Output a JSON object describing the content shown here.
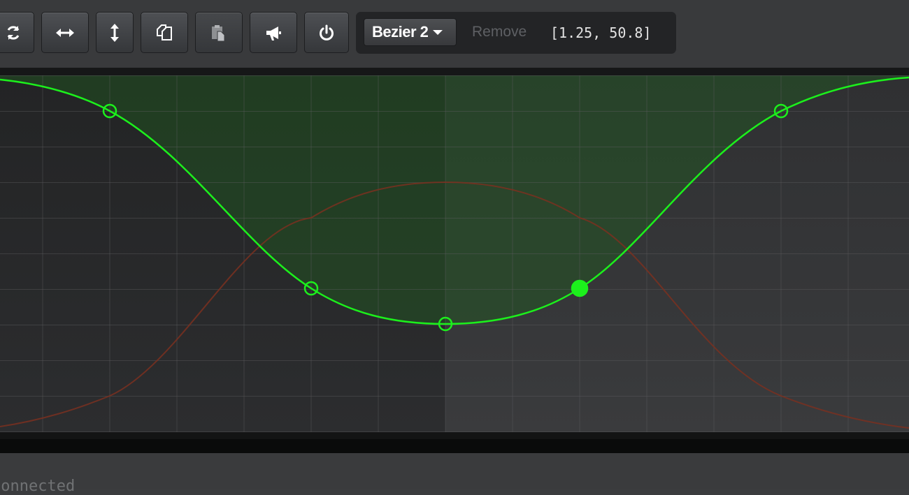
{
  "toolbar": {
    "buttons": [
      {
        "name": "refresh-button",
        "icon": "refresh-icon",
        "disabled": false
      },
      {
        "name": "flip-horizontal-button",
        "icon": "arrows-horizontal-icon",
        "disabled": false
      },
      {
        "name": "flip-vertical-button",
        "icon": "arrows-vertical-icon",
        "disabled": false
      },
      {
        "name": "copy-button",
        "icon": "copy-icon",
        "disabled": false
      },
      {
        "name": "paste-button",
        "icon": "paste-icon",
        "disabled": true
      },
      {
        "name": "announce-button",
        "icon": "megaphone-icon",
        "disabled": false
      },
      {
        "name": "power-button",
        "icon": "power-icon",
        "disabled": false
      }
    ],
    "bezier_select": {
      "value": "Bezier 2"
    },
    "remove_label": "Remove",
    "coords_readout": "[1.25, 50.8]"
  },
  "graph": {
    "colors": {
      "active_curve": "#1cf01c",
      "mirror_curve": "#7a3020",
      "fill": "#1e5a1e",
      "grid": "#5a5c5e"
    },
    "control_points": [
      {
        "name": "control-point-1",
        "selected": false
      },
      {
        "name": "control-point-2",
        "selected": false
      },
      {
        "name": "control-point-3",
        "selected": false
      },
      {
        "name": "control-point-4",
        "selected": true
      },
      {
        "name": "control-point-5",
        "selected": false
      }
    ]
  },
  "status": {
    "text": "Connected"
  }
}
